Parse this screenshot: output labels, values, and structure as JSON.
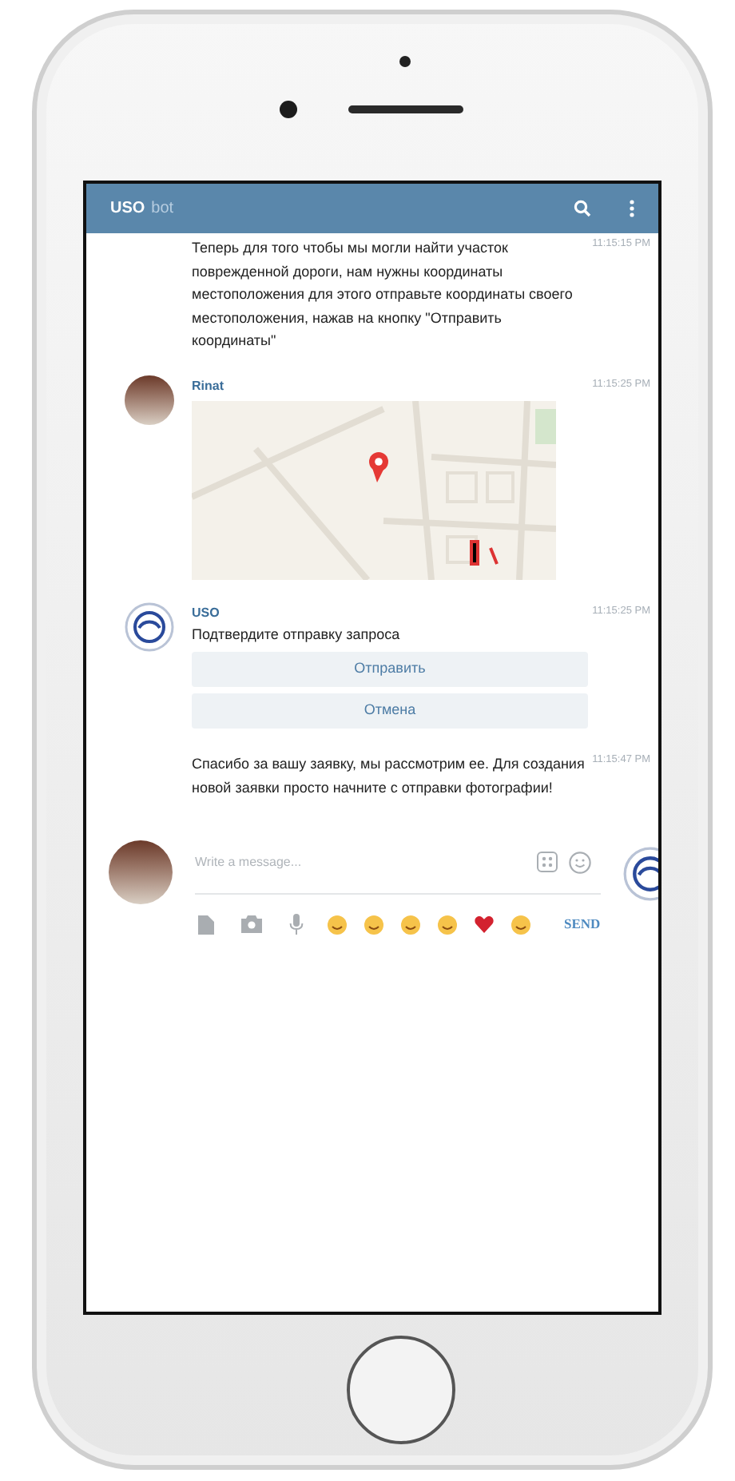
{
  "header": {
    "title": "USO",
    "subtitle": "bot"
  },
  "messages": [
    {
      "kind": "text",
      "text": "Теперь для того чтобы мы могли найти участок поврежденной дороги, нам нужны координаты местоположения для этого отправьте координаты своего местоположения, нажав на кнопку \"Отправить координаты\"",
      "time": "11:15:15 PM"
    },
    {
      "kind": "location",
      "author": "Rinat",
      "avatar": {
        "kind": "photo"
      },
      "time": "11:15:25 PM"
    },
    {
      "kind": "keyboard",
      "author": "USO",
      "avatar": {
        "kind": "logo"
      },
      "text": "Подтвердите отправку запроса",
      "buttons": [
        "Отправить",
        "Отмена"
      ],
      "time": "11:15:25 PM"
    },
    {
      "kind": "text",
      "text": "Спасибо за вашу заявку, мы рассмотрим ее. Для создания новой заявки просто начните с отправки фотографии!",
      "time": "11:15:47 PM"
    }
  ],
  "composer": {
    "placeholder": "Write a message...",
    "send": "SEND"
  }
}
